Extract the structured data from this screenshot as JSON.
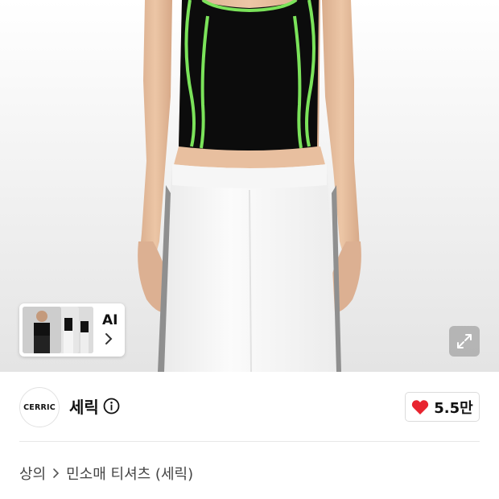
{
  "product_image": {
    "description_icon": "product-photo",
    "ai_badge_label": "AI",
    "thumbnail_count": 3
  },
  "brand": {
    "logo_text": "CERRIC",
    "name": "세릭",
    "info_icon": "info-icon"
  },
  "like": {
    "icon": "heart-icon",
    "count": "5.5만",
    "heart_color": "#e8242f"
  },
  "breadcrumb": {
    "category": "상의",
    "subcategory": "민소매 티셔츠 (세릭)"
  }
}
